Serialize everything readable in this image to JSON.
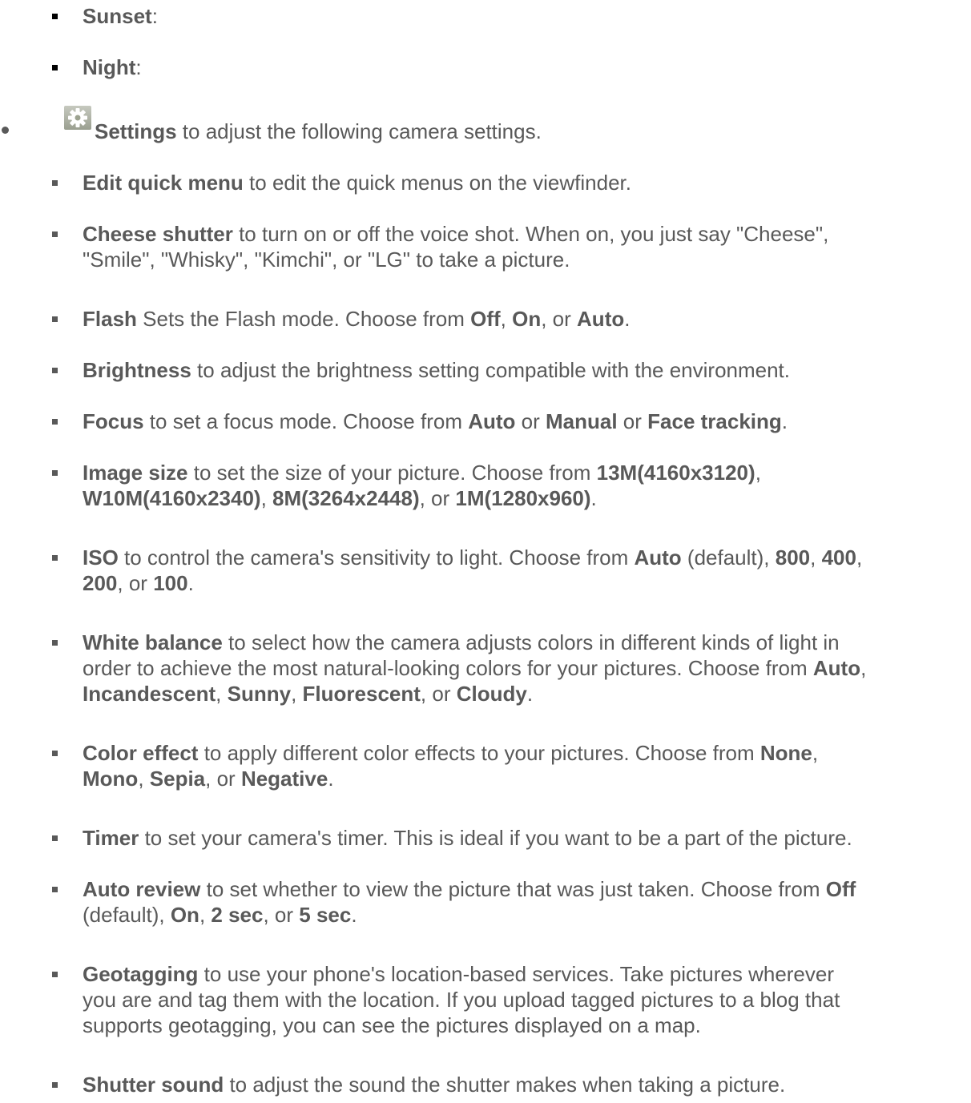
{
  "items_top": [
    {
      "term": "Sunset",
      "rest": ":"
    },
    {
      "term": "Night",
      "rest": ":"
    }
  ],
  "settings": {
    "icon": "gear-icon",
    "term": "Settings",
    "rest": " to adjust the following camera settings."
  },
  "settings_items": [
    {
      "lines": [
        [
          {
            "b": "Edit quick menu"
          },
          {
            "t": " to edit the quick menus on the viewfinder."
          }
        ]
      ]
    },
    {
      "lines": [
        [
          {
            "b": "Cheese shutter"
          },
          {
            "t": " to turn on or off the voice shot. When on, you just say \"Cheese\","
          }
        ],
        [
          {
            "t": "\"Smile\", \"Whisky\", \"Kimchi\", or \"LG\" to take a picture."
          }
        ]
      ]
    },
    {
      "lines": [
        [
          {
            "b": "Flash"
          },
          {
            "t": " Sets the Flash mode. Choose from "
          },
          {
            "b": "Off"
          },
          {
            "t": ", "
          },
          {
            "b": "On"
          },
          {
            "t": ", or "
          },
          {
            "b": "Auto"
          },
          {
            "t": "."
          }
        ]
      ]
    },
    {
      "lines": [
        [
          {
            "b": "Brightness"
          },
          {
            "t": " to adjust the brightness setting compatible with the environment."
          }
        ]
      ]
    },
    {
      "lines": [
        [
          {
            "b": "Focus"
          },
          {
            "t": " to set a focus mode. Choose from "
          },
          {
            "b": "Auto"
          },
          {
            "t": " or "
          },
          {
            "b": "Manual"
          },
          {
            "t": " or "
          },
          {
            "b": "Face tracking"
          },
          {
            "t": "."
          }
        ]
      ]
    },
    {
      "lines": [
        [
          {
            "b": "Image size"
          },
          {
            "t": " to set the size of your picture. Choose from "
          },
          {
            "b": "13M(4160x3120)"
          },
          {
            "t": ","
          }
        ],
        [
          {
            "b": "W10M(4160x2340)"
          },
          {
            "t": ", "
          },
          {
            "b": "8M(3264x2448)"
          },
          {
            "t": ", or "
          },
          {
            "b": "1M(1280x960)"
          },
          {
            "t": "."
          }
        ]
      ]
    },
    {
      "lines": [
        [
          {
            "b": "ISO"
          },
          {
            "t": " to control the camera's sensitivity to light. Choose from "
          },
          {
            "b": "Auto"
          },
          {
            "t": " (default), "
          },
          {
            "b": "800"
          },
          {
            "t": ", "
          },
          {
            "b": "400"
          },
          {
            "t": ","
          }
        ],
        [
          {
            "b": "200"
          },
          {
            "t": ", or "
          },
          {
            "b": "100"
          },
          {
            "t": "."
          }
        ]
      ]
    },
    {
      "lines": [
        [
          {
            "b": "White balance"
          },
          {
            "t": " to select how the camera adjusts colors in different kinds of light in"
          }
        ],
        [
          {
            "t": "order to achieve the most natural-looking colors for your pictures. Choose from "
          },
          {
            "b": "Auto"
          },
          {
            "t": ","
          }
        ],
        [
          {
            "b": "Incandescent"
          },
          {
            "t": ", "
          },
          {
            "b": "Sunny"
          },
          {
            "t": ", "
          },
          {
            "b": "Fluorescent"
          },
          {
            "t": ", or "
          },
          {
            "b": "Cloudy"
          },
          {
            "t": "."
          }
        ]
      ]
    },
    {
      "lines": [
        [
          {
            "b": "Color effect"
          },
          {
            "t": " to apply different color effects to your pictures. Choose from "
          },
          {
            "b": "None"
          },
          {
            "t": ","
          }
        ],
        [
          {
            "b": "Mono"
          },
          {
            "t": ", "
          },
          {
            "b": "Sepia"
          },
          {
            "t": ", or "
          },
          {
            "b": "Negative"
          },
          {
            "t": "."
          }
        ]
      ]
    },
    {
      "lines": [
        [
          {
            "b": "Timer"
          },
          {
            "t": " to set your camera's timer. This is ideal if you want to be a part of the picture."
          }
        ]
      ]
    },
    {
      "lines": [
        [
          {
            "b": "Auto review"
          },
          {
            "t": " to set whether to view the picture that was just taken. Choose from "
          },
          {
            "b": "Off"
          }
        ],
        [
          {
            "t": "(default), "
          },
          {
            "b": "On"
          },
          {
            "t": ", "
          },
          {
            "b": "2 sec"
          },
          {
            "t": ", or "
          },
          {
            "b": "5 sec"
          },
          {
            "t": "."
          }
        ]
      ]
    },
    {
      "lines": [
        [
          {
            "b": "Geotagging"
          },
          {
            "t": " to use your phone's location-based services. Take pictures wherever"
          }
        ],
        [
          {
            "t": "you are and tag them with the location. If you upload tagged pictures to a blog that"
          }
        ],
        [
          {
            "t": "supports geotagging, you can see the pictures displayed on a map."
          }
        ]
      ]
    },
    {
      "lines": [
        [
          {
            "b": "Shutter sound"
          },
          {
            "t": " to adjust the sound the shutter makes when taking a picture."
          }
        ]
      ]
    }
  ]
}
